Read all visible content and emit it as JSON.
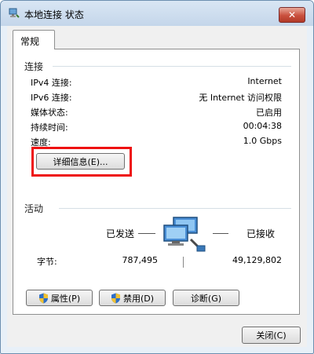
{
  "window": {
    "title": "本地连接 状态",
    "close_glyph": "✕"
  },
  "tab": {
    "label": "常规"
  },
  "connection": {
    "title": "连接",
    "rows": [
      {
        "label": "IPv4 连接:",
        "value": "Internet"
      },
      {
        "label": "IPv6 连接:",
        "value": "无 Internet 访问权限"
      },
      {
        "label": "媒体状态:",
        "value": "已启用"
      },
      {
        "label": "持续时间:",
        "value": "00:04:38"
      },
      {
        "label": "速度:",
        "value": "1.0 Gbps"
      }
    ],
    "details_button": "详细信息(E)..."
  },
  "activity": {
    "title": "活动",
    "sent_label": "已发送",
    "received_label": "已接收",
    "bytes_label": "字节:",
    "bytes_sent": "787,495",
    "bytes_received": "49,129,802"
  },
  "buttons": {
    "properties": "属性(P)",
    "disable": "禁用(D)",
    "diagnose": "诊断(G)",
    "close": "关闭(C)"
  },
  "colors": {
    "highlight": "#ee1111",
    "titlebar": "#c4d6ea"
  }
}
